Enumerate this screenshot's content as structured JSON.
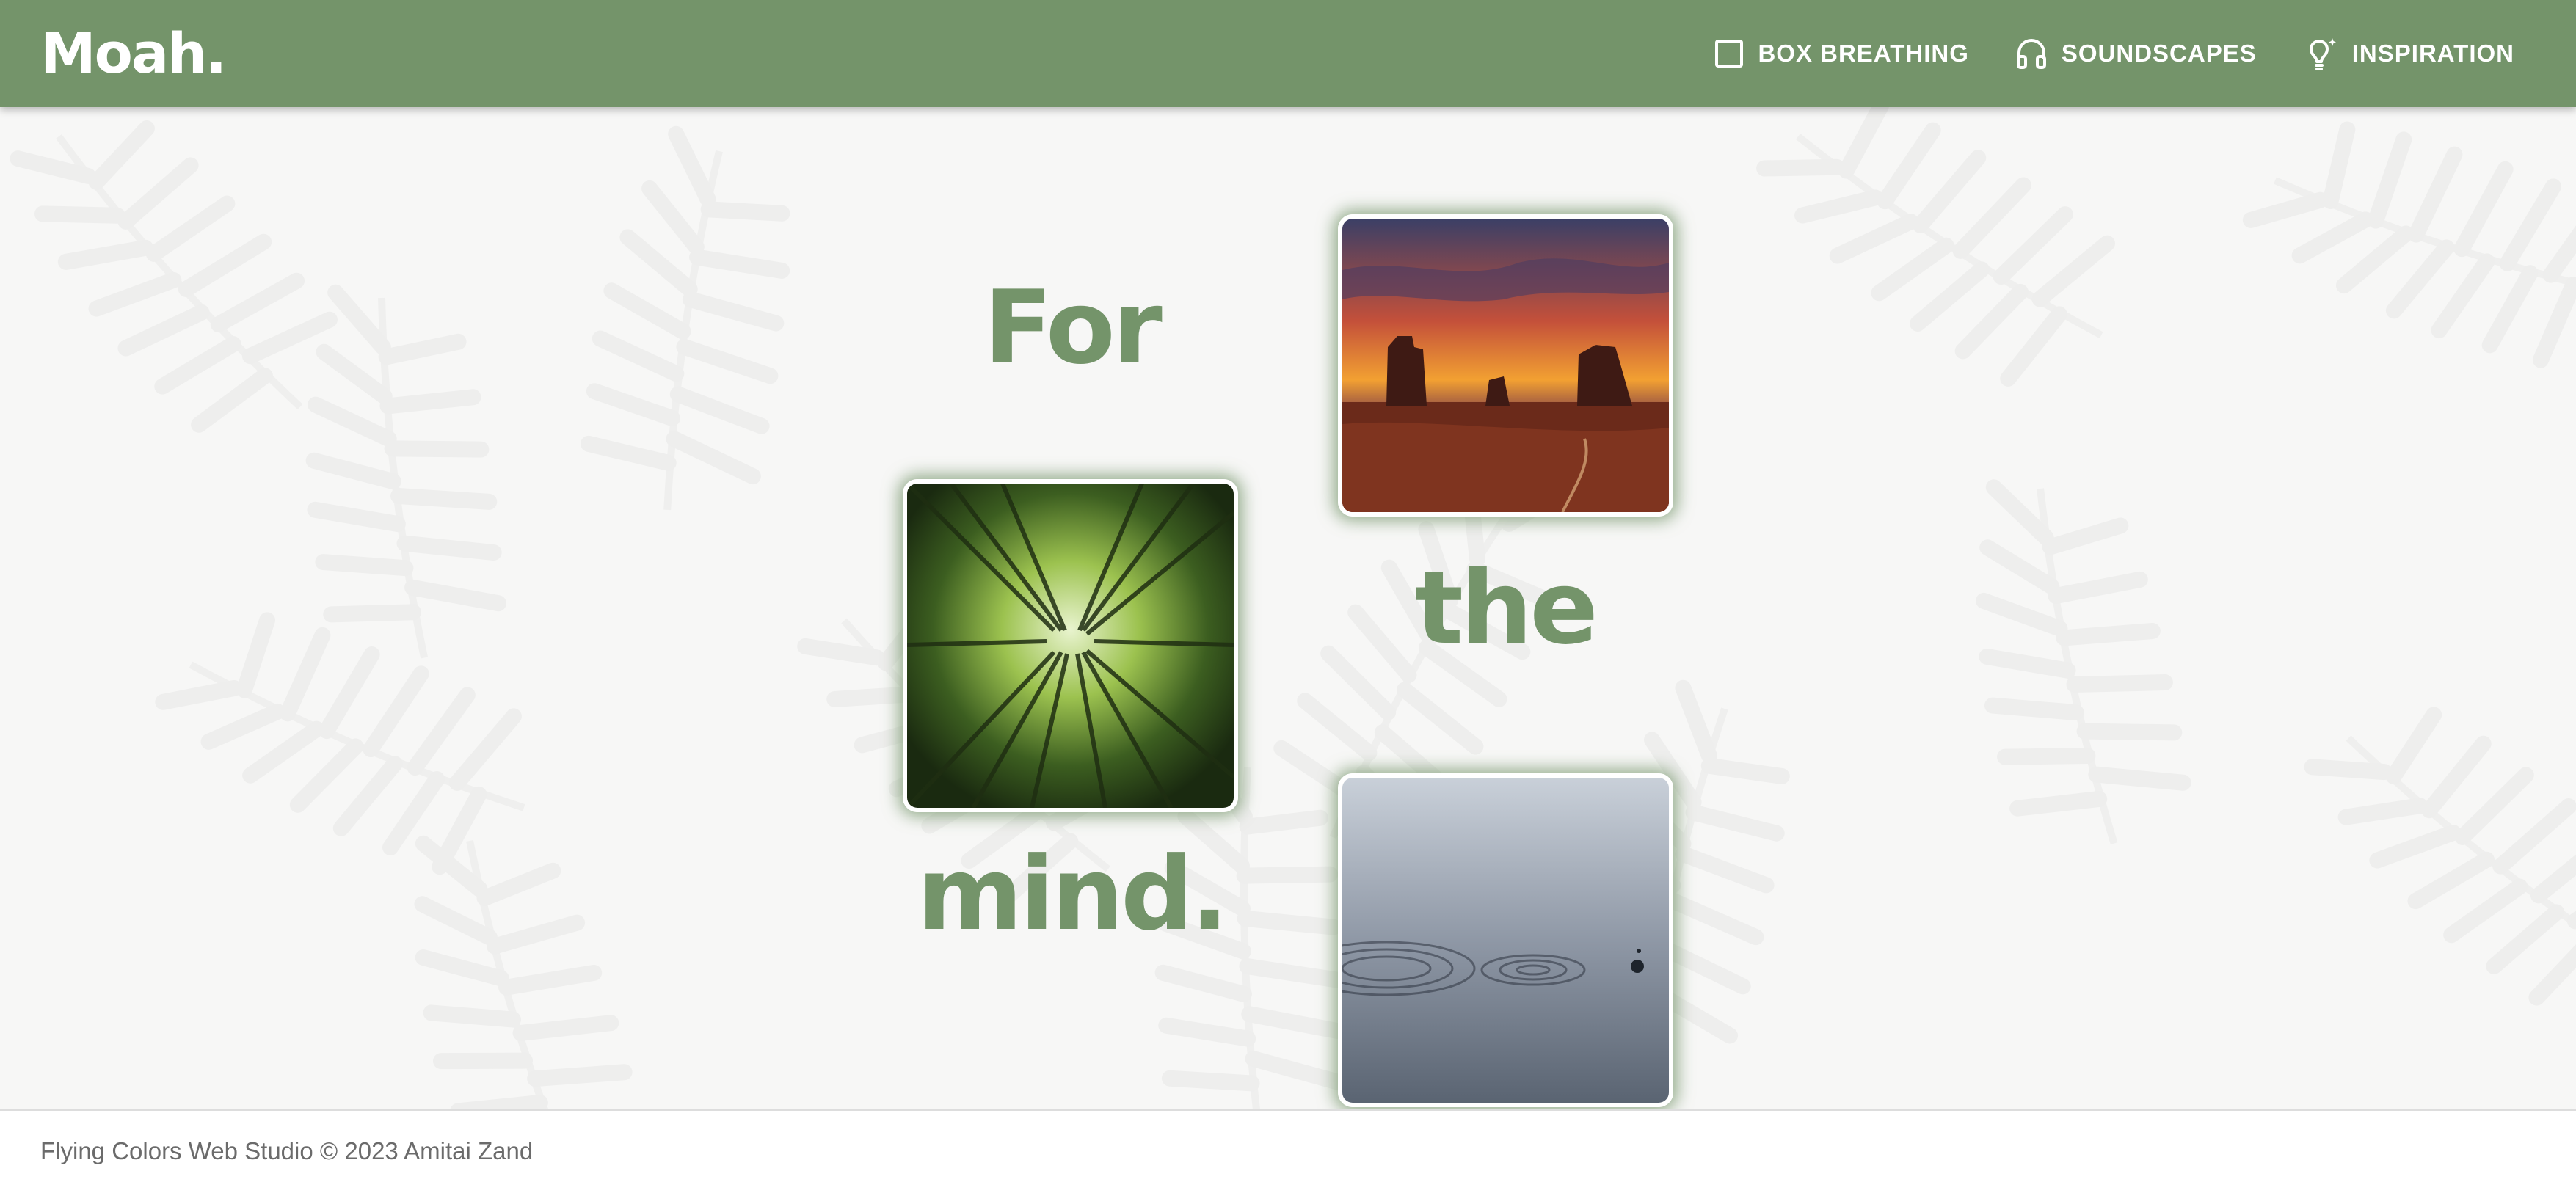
{
  "header": {
    "logo": "Moah.",
    "nav": [
      {
        "label": "BOX BREATHING",
        "icon": "square-icon"
      },
      {
        "label": "SOUNDSCAPES",
        "icon": "headphones-icon"
      },
      {
        "label": "INSPIRATION",
        "icon": "lightbulb-icon"
      }
    ]
  },
  "hero": {
    "words": [
      "For",
      "the",
      "mind."
    ],
    "images": [
      {
        "subject": "desert-mesas-sunset"
      },
      {
        "subject": "bamboo-forest-canopy"
      },
      {
        "subject": "water-ripples"
      }
    ]
  },
  "footer": {
    "text": "Flying Colors Web Studio © 2023 Amitai Zand"
  },
  "colors": {
    "brand_green": "#74946a",
    "header_text": "#ffffff",
    "footer_text": "#6b6b6b",
    "background": "#f7f7f6"
  }
}
